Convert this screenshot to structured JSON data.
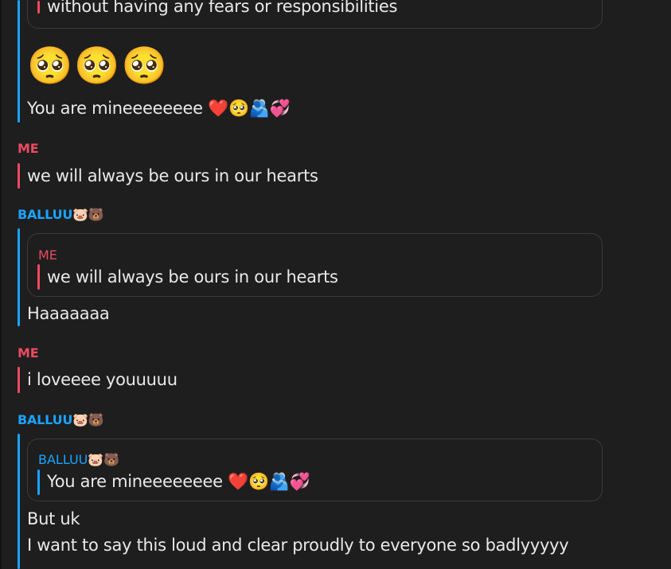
{
  "chat": {
    "block1": {
      "quote_text": "without having any fears or responsibilities",
      "emojis": "🥺🥺🥺",
      "message": "You are mineeeeeeee ❤️🥺🫂💞"
    },
    "block2": {
      "sender": "ME",
      "message": "we will always be ours in our hearts"
    },
    "block3": {
      "sender": "BALLUU🐷🐻",
      "quote_sender": "ME",
      "quote_text": "we will always be ours in our hearts",
      "message": "Haaaaaaa"
    },
    "block4": {
      "sender": "ME",
      "message": "i loveeee youuuuu"
    },
    "block5": {
      "sender": "BALLUU🐷🐻",
      "quote_sender": "BALLUU🐷🐻",
      "quote_text": "You are mineeeeeeee ❤️🥺🫂💞",
      "message_line1": "But uk",
      "message_line2": "I want to say this loud and clear proudly to everyone so badlyyyyy"
    }
  },
  "colors": {
    "background": "#1e1e1e",
    "me_accent": "#ec4a61",
    "other_accent": "#1aa3ff",
    "text": "#e9e9e9",
    "quote_border": "#3b3b3b"
  }
}
